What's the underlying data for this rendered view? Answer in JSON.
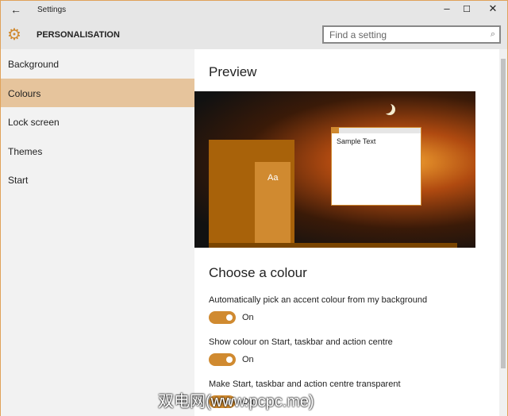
{
  "window": {
    "title": "Settings",
    "back": "←",
    "minimize": "–",
    "maximize": "☐",
    "close": "✕"
  },
  "header": {
    "title": "PERSONALISATION",
    "search_placeholder": "Find a setting",
    "gear": "⚙",
    "search_icon": "⌕"
  },
  "sidebar": {
    "items": [
      {
        "label": "Background"
      },
      {
        "label": "Colours"
      },
      {
        "label": "Lock screen"
      },
      {
        "label": "Themes"
      },
      {
        "label": "Start"
      }
    ]
  },
  "main": {
    "preview_title": "Preview",
    "sample_text": "Sample Text",
    "tile_label": "Aa",
    "choose_title": "Choose a colour",
    "settings": [
      {
        "label": "Automatically pick an accent colour from my background",
        "state": "On"
      },
      {
        "label": "Show colour on Start, taskbar and action centre",
        "state": "On"
      },
      {
        "label": "Make Start, taskbar and action centre transparent",
        "state": "On"
      }
    ]
  },
  "accent": "#d08a30",
  "watermark": "双电网(www.pcpc.me)"
}
